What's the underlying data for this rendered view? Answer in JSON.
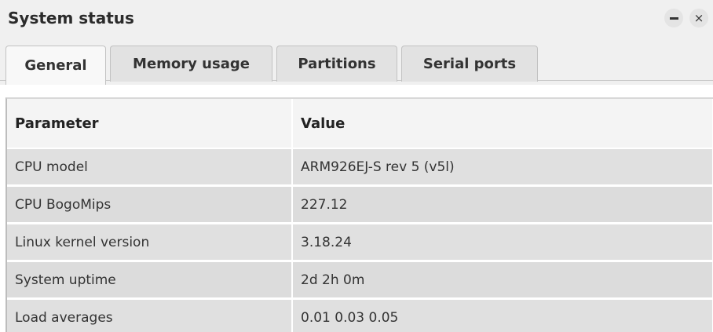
{
  "window": {
    "title": "System status",
    "minimize_icon": "minimize-icon",
    "close_icon": "close-icon",
    "close_glyph": "×"
  },
  "tabs": [
    {
      "label": "General",
      "active": true
    },
    {
      "label": "Memory usage",
      "active": false
    },
    {
      "label": "Partitions",
      "active": false
    },
    {
      "label": "Serial ports",
      "active": false
    }
  ],
  "table": {
    "headers": [
      "Parameter",
      "Value"
    ],
    "rows": [
      [
        "CPU model",
        "ARM926EJ-S rev 5 (v5l)"
      ],
      [
        "CPU BogoMips",
        "227.12"
      ],
      [
        "Linux kernel version",
        "3.18.24"
      ],
      [
        "System uptime",
        "2d 2h 0m"
      ],
      [
        "Load averages",
        "0.01 0.03 0.05"
      ]
    ]
  }
}
